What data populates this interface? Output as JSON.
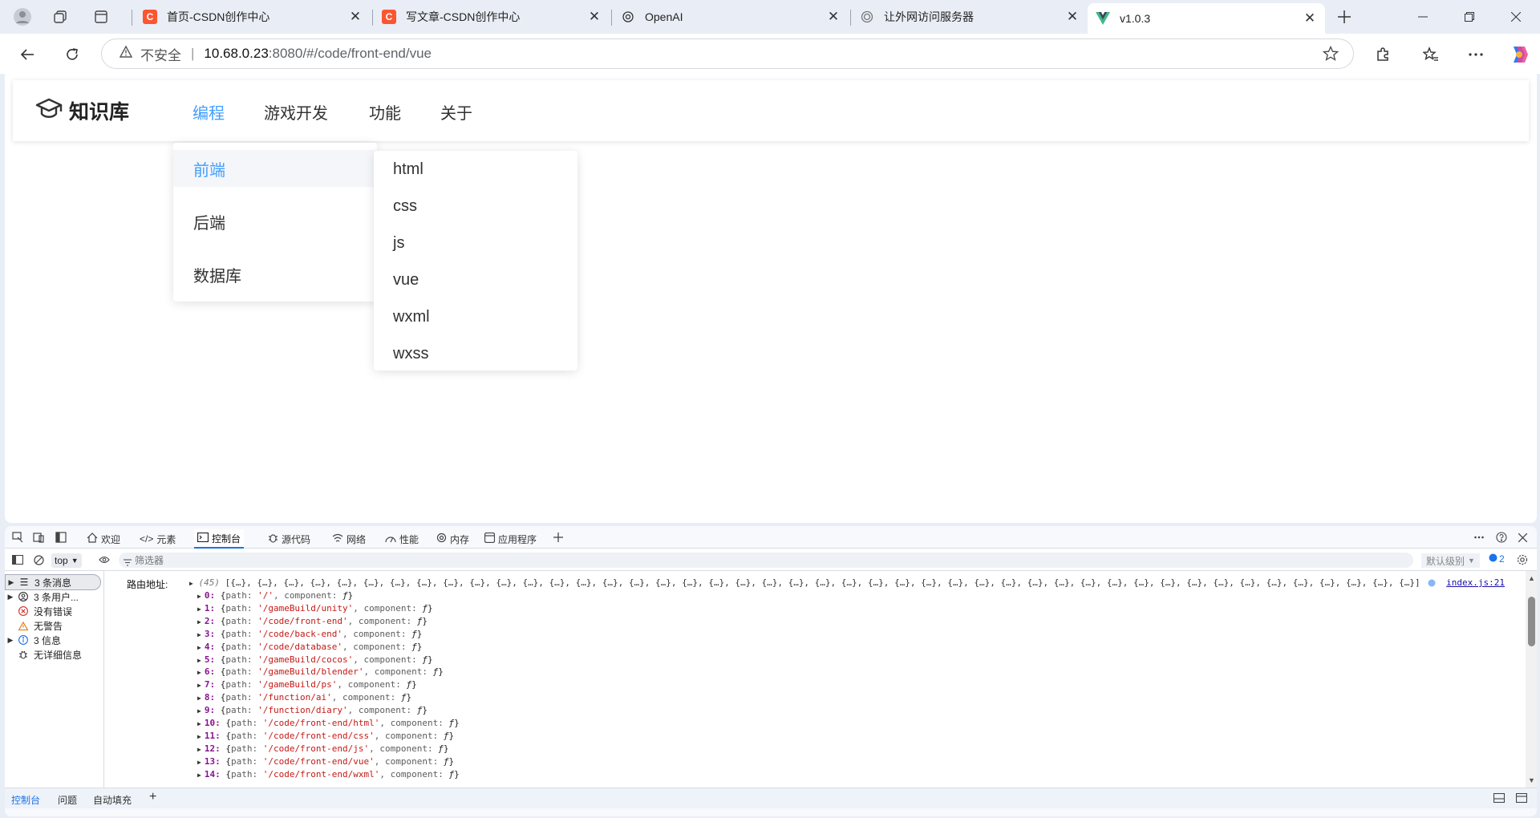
{
  "browser": {
    "tabs": [
      {
        "title": "首页-CSDN创作中心",
        "favicon": "C",
        "favicon_color": "#fc5531"
      },
      {
        "title": "写文章-CSDN创作中心",
        "favicon": "C",
        "favicon_color": "#fc5531"
      },
      {
        "title": "OpenAI",
        "favicon": "openai-icon"
      },
      {
        "title": "让外网访问服务器",
        "favicon": "globe-icon"
      },
      {
        "title": "v1.0.3",
        "favicon": "vue-icon",
        "active": true
      }
    ],
    "address": {
      "security": "不安全",
      "host": "10.68.0.23",
      "rest": ":8080/#/code/front-end/vue"
    }
  },
  "site": {
    "brand": "知识库",
    "nav": [
      "编程",
      "游戏开发",
      "功能",
      "关于"
    ],
    "active_nav": "编程",
    "accent_color": "#409eff",
    "menu": [
      "前端",
      "后端",
      "数据库"
    ],
    "submenu": [
      "html",
      "css",
      "js",
      "vue",
      "wxml",
      "wxss"
    ]
  },
  "devtools": {
    "tabs": [
      "欢迎",
      "元素",
      "控制台",
      "源代码",
      "网络",
      "性能",
      "内存",
      "应用程序"
    ],
    "active_tab": "控制台",
    "context": "top",
    "filter_placeholder": "筛选器",
    "level": "默认级别",
    "issues_count": "2",
    "sidebar": [
      {
        "label": "3 条消息",
        "icon": "list-icon",
        "expandable": true,
        "selected": true
      },
      {
        "label": "3 条用户...",
        "icon": "user-icon",
        "expandable": true
      },
      {
        "label": "没有错误",
        "icon": "error-icon"
      },
      {
        "label": "无警告",
        "icon": "warning-icon"
      },
      {
        "label": "3 信息",
        "icon": "info-icon",
        "expandable": true
      },
      {
        "label": "无详细信息",
        "icon": "bug-icon"
      }
    ],
    "console": {
      "label": "路由地址:",
      "count": "(45)",
      "array_preview": "[{…}, {…}, {…}, {…}, {…}, {…}, {…}, {…}, {…}, {…}, {…}, {…}, {…}, {…}, {…}, {…}, {…}, {…}, {…}, {…}, {…}, {…}, {…}, {…}, {…}, {…}, {…}, {…}, {…}, {…}, {…}, {…}, {…}, {…}, {…}, {…}, {…}, {…}, {…}, {…}, {…}, {…}, {…}, {…}, {…}]",
      "source": "index.js:21",
      "entries": [
        {
          "idx": "0",
          "path": "'/'"
        },
        {
          "idx": "1",
          "path": "'/gameBuild/unity'"
        },
        {
          "idx": "2",
          "path": "'/code/front-end'"
        },
        {
          "idx": "3",
          "path": "'/code/back-end'"
        },
        {
          "idx": "4",
          "path": "'/code/database'"
        },
        {
          "idx": "5",
          "path": "'/gameBuild/cocos'"
        },
        {
          "idx": "6",
          "path": "'/gameBuild/blender'"
        },
        {
          "idx": "7",
          "path": "'/gameBuild/ps'"
        },
        {
          "idx": "8",
          "path": "'/function/ai'"
        },
        {
          "idx": "9",
          "path": "'/function/diary'"
        },
        {
          "idx": "10",
          "path": "'/code/front-end/html'"
        },
        {
          "idx": "11",
          "path": "'/code/front-end/css'"
        },
        {
          "idx": "12",
          "path": "'/code/front-end/js'"
        },
        {
          "idx": "13",
          "path": "'/code/front-end/vue'"
        },
        {
          "idx": "14",
          "path": "'/code/front-end/wxml'"
        }
      ]
    },
    "drawer_tabs": [
      "控制台",
      "问题",
      "自动填充"
    ]
  }
}
